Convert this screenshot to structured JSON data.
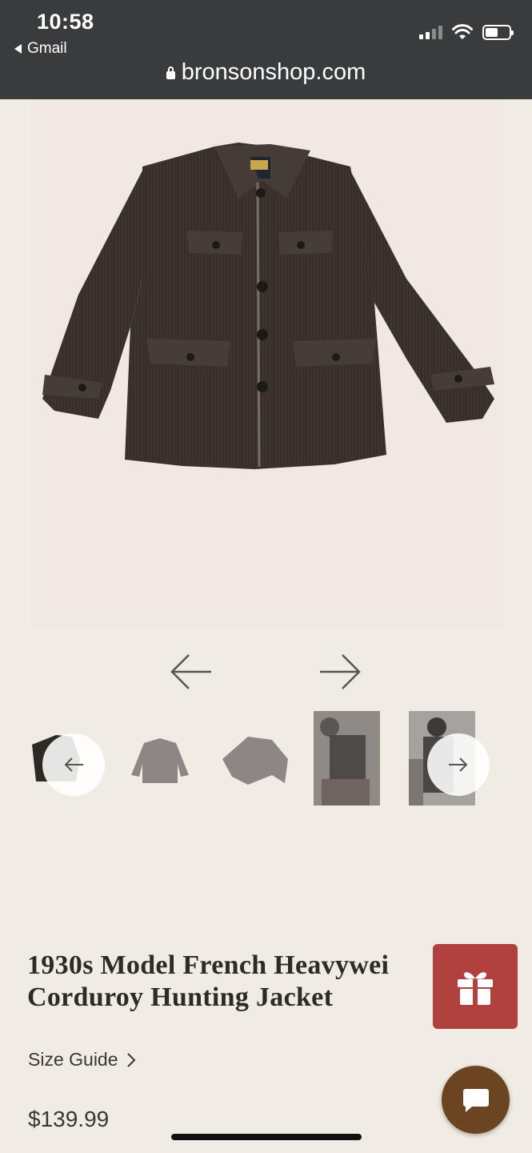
{
  "status_bar": {
    "time": "10:58",
    "back_app": "Gmail"
  },
  "browser": {
    "url": "bronsonshop.com"
  },
  "gallery": {
    "prev_icon": "arrow-left-icon",
    "next_icon": "arrow-right-icon"
  },
  "thumbnails": {
    "count_visible": 5,
    "prev_icon": "chevron-left-icon",
    "next_icon": "chevron-right-icon"
  },
  "product": {
    "title_line1": "1930s Model French Heavywei",
    "title_line2": "Corduroy Hunting Jacket",
    "size_guide": "Size Guide",
    "price": "$139.99"
  },
  "floating": {
    "gift_icon": "gift-icon",
    "chat_icon": "chat-icon"
  },
  "colors": {
    "background": "#f0ebe3",
    "topbar": "#3a3b3d",
    "gift_button": "#b0413e",
    "chat_button": "#6b4521"
  }
}
